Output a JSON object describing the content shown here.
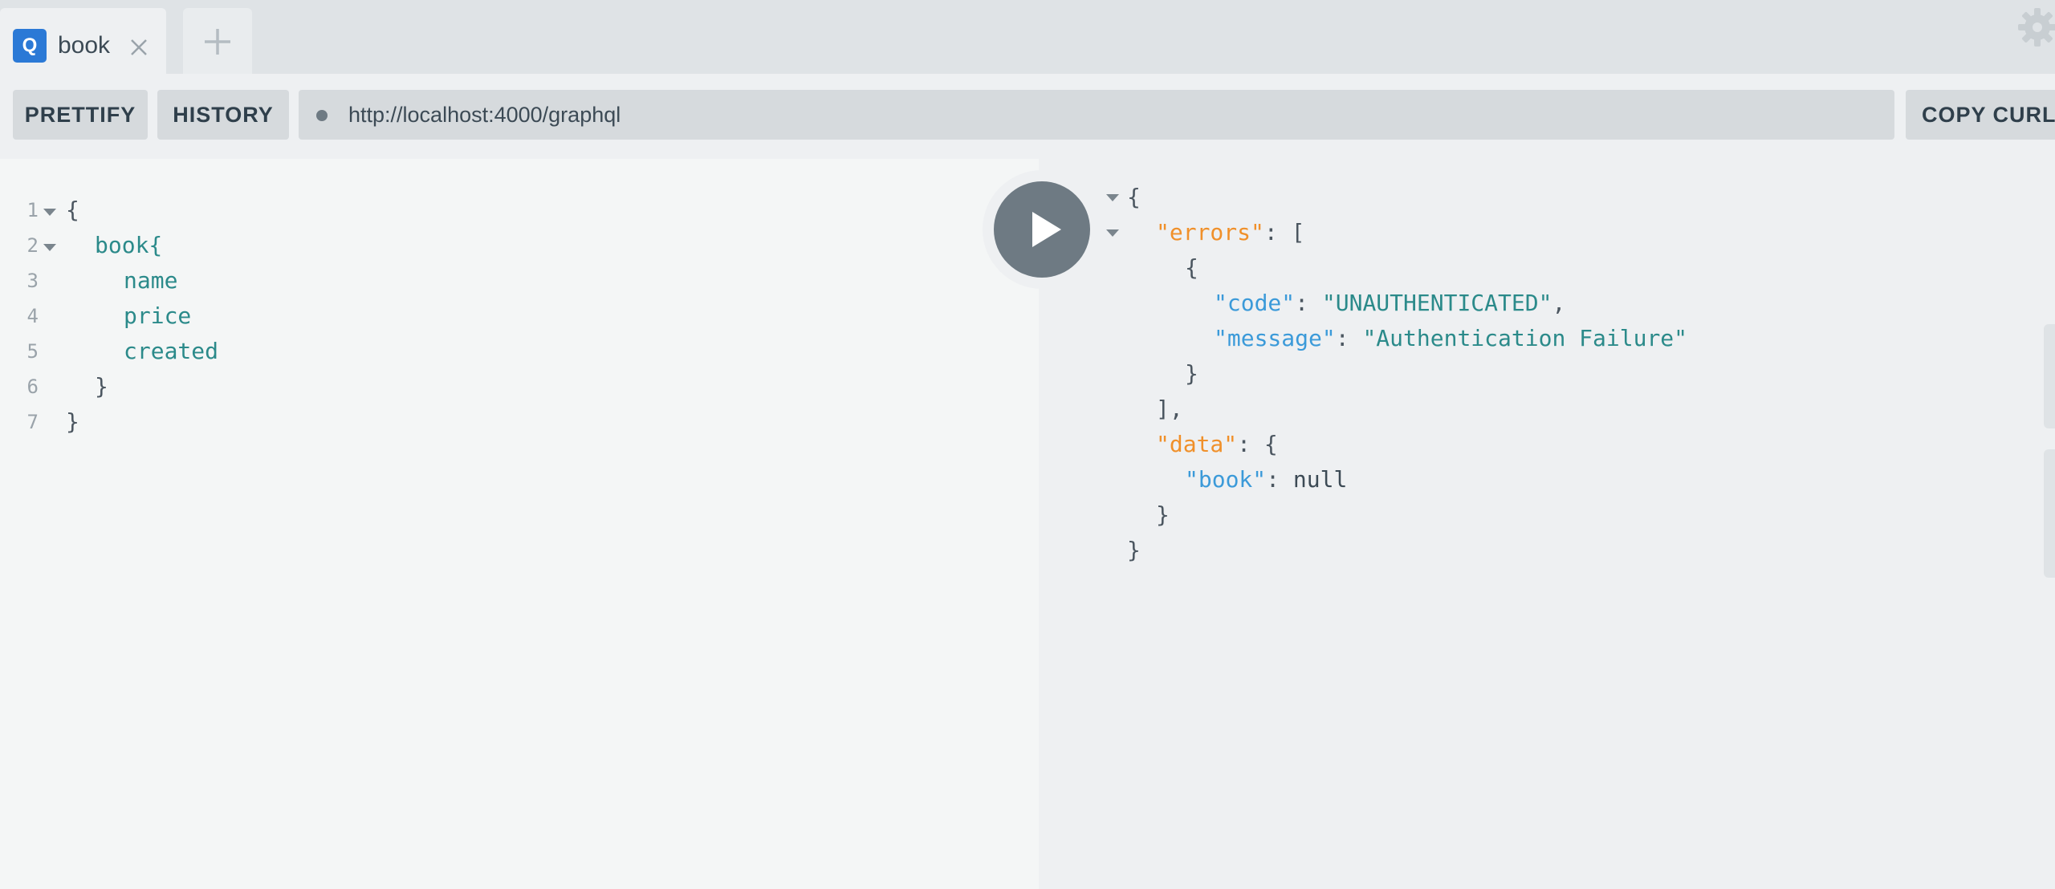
{
  "tabs": [
    {
      "badge": "Q",
      "title": "book"
    }
  ],
  "toolbar": {
    "prettify_label": "PRETTIFY",
    "history_label": "HISTORY",
    "endpoint_url": "http://localhost:4000/graphql",
    "copy_curl_label": "COPY CURL"
  },
  "query_editor": {
    "lines": [
      {
        "number": "1",
        "text": "{"
      },
      {
        "number": "2",
        "text": "book{"
      },
      {
        "number": "3",
        "text": "name"
      },
      {
        "number": "4",
        "text": "price"
      },
      {
        "number": "5",
        "text": "created"
      },
      {
        "number": "6",
        "text": "}"
      },
      {
        "number": "7",
        "text": "}"
      }
    ]
  },
  "response": {
    "open_brace": "{",
    "errors_key": "\"errors\"",
    "errors_open": ": [",
    "error_obj_open": "{",
    "code_key": "\"code\"",
    "code_value": "\"UNAUTHENTICATED\"",
    "message_key": "\"message\"",
    "message_value": "\"Authentication Failure\"",
    "error_obj_close": "}",
    "errors_close": "],",
    "data_key": "\"data\"",
    "data_open": ": {",
    "book_key": "\"book\"",
    "book_value": "null",
    "data_close": "}",
    "close_brace": "}"
  },
  "colors": {
    "badge_blue": "#2b79d6",
    "play_button": "#6e7a83",
    "key_orange": "#f0902a",
    "key_blue": "#3b9ad9",
    "string_teal": "#2b8a8a"
  },
  "icons": {
    "tab_close": "close-icon",
    "new_tab": "plus-icon",
    "settings": "gear-icon",
    "run": "play-icon"
  }
}
